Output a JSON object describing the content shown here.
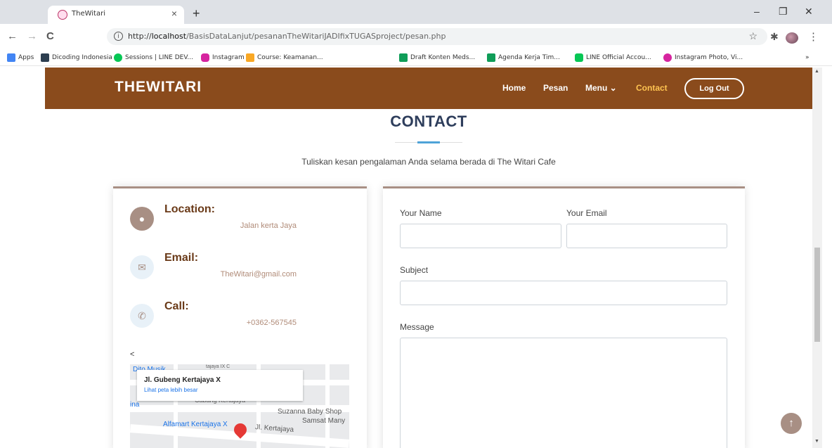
{
  "browser": {
    "tab_title": "TheWitari",
    "tab_close": "×",
    "new_tab": "+",
    "minimize": "–",
    "restore": "❐",
    "close": "✕",
    "back": "←",
    "forward": "→",
    "reload": "C",
    "url_prefix": "http://",
    "url_host": "localhost",
    "url_path": "/BasisDataLanjut/pesananTheWitariJADIfixTUGASproject/pesan.php",
    "bookmarks": [
      {
        "label": "Apps",
        "color": "#4285f4"
      },
      {
        "label": "Dicoding Indonesia",
        "color": "#2d3e50"
      },
      {
        "label": "Sessions | LINE DEV...",
        "color": "#06c755"
      },
      {
        "label": "Instagram",
        "color": "#d6249f"
      },
      {
        "label": "Course: Keamanan...",
        "color": "#f9a825"
      },
      {
        "label": "Draft Konten Meds...",
        "color": "#0f9d58"
      },
      {
        "label": "Agenda Kerja Tim...",
        "color": "#0f9d58"
      },
      {
        "label": "LINE Official Accou...",
        "color": "#06c755"
      },
      {
        "label": "Instagram Photo, Vi...",
        "color": "#d6249f"
      }
    ],
    "more_bookmarks": "»"
  },
  "nav": {
    "logo": "THEWITARI",
    "links": [
      "Home",
      "Pesan",
      "Menu ⌄",
      "Contact"
    ],
    "logout": "Log Out"
  },
  "contact": {
    "title": "CONTACT",
    "subtitle": "Tuliskan kesan pengalaman Anda selama berada di The Witari Cafe",
    "location_label": "Location:",
    "location_value": "Jalan kerta Jaya",
    "email_label": "Email:",
    "email_value": "TheWitari@gmail.com",
    "call_label": "Call:",
    "call_value": "+0362-567545",
    "stray_text": "<"
  },
  "map": {
    "card_title": "Jl. Gubeng Kertajaya X",
    "card_link": "Lihat peta lebih besar",
    "labels": {
      "dito": "Dito Musik",
      "kertajaya_ix": "tajaya IX C",
      "cabang": "Cabang Kertajaya",
      "suzanna": "Suzanna Baby Shop",
      "samsat": "Samsat Many",
      "alfamart": "Alfamart Kertajaya X",
      "jl_kertajaya": "Jl. Kertajaya",
      "ina": "ina"
    }
  },
  "form": {
    "name_label": "Your Name",
    "email_label": "Your Email",
    "subject_label": "Subject",
    "message_label": "Message"
  },
  "colors": {
    "nav_bg": "#8a4b1c",
    "accent": "#ffc451",
    "title": "#2e3e5c",
    "brown": "#a88f84"
  }
}
